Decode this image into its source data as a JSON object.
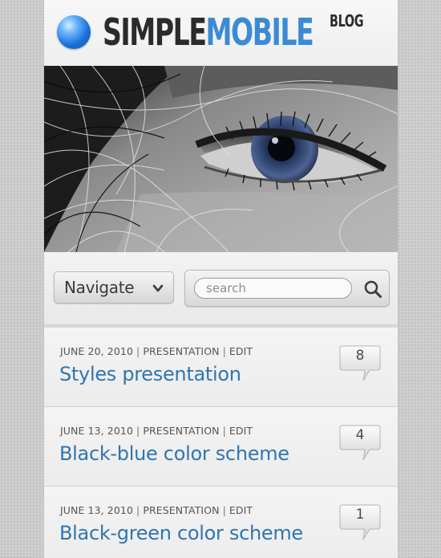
{
  "header": {
    "logo_simple": "SIMPLE",
    "logo_mobile": "MOBILE",
    "logo_blog": "BLOG",
    "icon": "globe-icon"
  },
  "toolbar": {
    "navigate_label": "Navigate",
    "search_placeholder": "search",
    "search_icon": "magnifier-icon"
  },
  "colors": {
    "accent": "#3b8ad4",
    "title_link": "#2f75b0",
    "logo_dark": "#2b2b2b"
  },
  "posts": [
    {
      "date": "JUNE 20, 2010",
      "category": "PRESENTATION",
      "edit": "EDIT",
      "title": "Styles presentation",
      "comments": "8"
    },
    {
      "date": "JUNE 13, 2010",
      "category": "PRESENTATION",
      "edit": "EDIT",
      "title": "Black-blue color scheme",
      "comments": "4"
    },
    {
      "date": "JUNE 13, 2010",
      "category": "PRESENTATION",
      "edit": "EDIT",
      "title": "Black-green color scheme",
      "comments": "1"
    }
  ]
}
